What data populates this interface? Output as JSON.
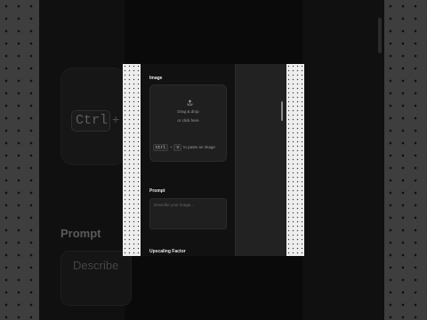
{
  "image_section": {
    "label": "Image",
    "upload_icon": "upload-icon",
    "drag_text": "Drag & drop",
    "click_text": "or click here",
    "shortcut_key1": "Ctrl",
    "shortcut_plus": "+",
    "shortcut_key2": "V",
    "paste_text": "to paste an image"
  },
  "prompt_section": {
    "label": "Prompt",
    "placeholder": "Describe your image..."
  },
  "upscale_section": {
    "label": "Upscaling Factor"
  },
  "background": {
    "kbd_text": "Ctrl",
    "plus_text": "+",
    "prompt_label": "Prompt",
    "describe_text": "Describe"
  },
  "colors": {
    "panel_bg": "#111111",
    "card_bg": "#1f1f1f",
    "label_text": "#e8e8e8",
    "muted_text": "#9a9a9a"
  }
}
